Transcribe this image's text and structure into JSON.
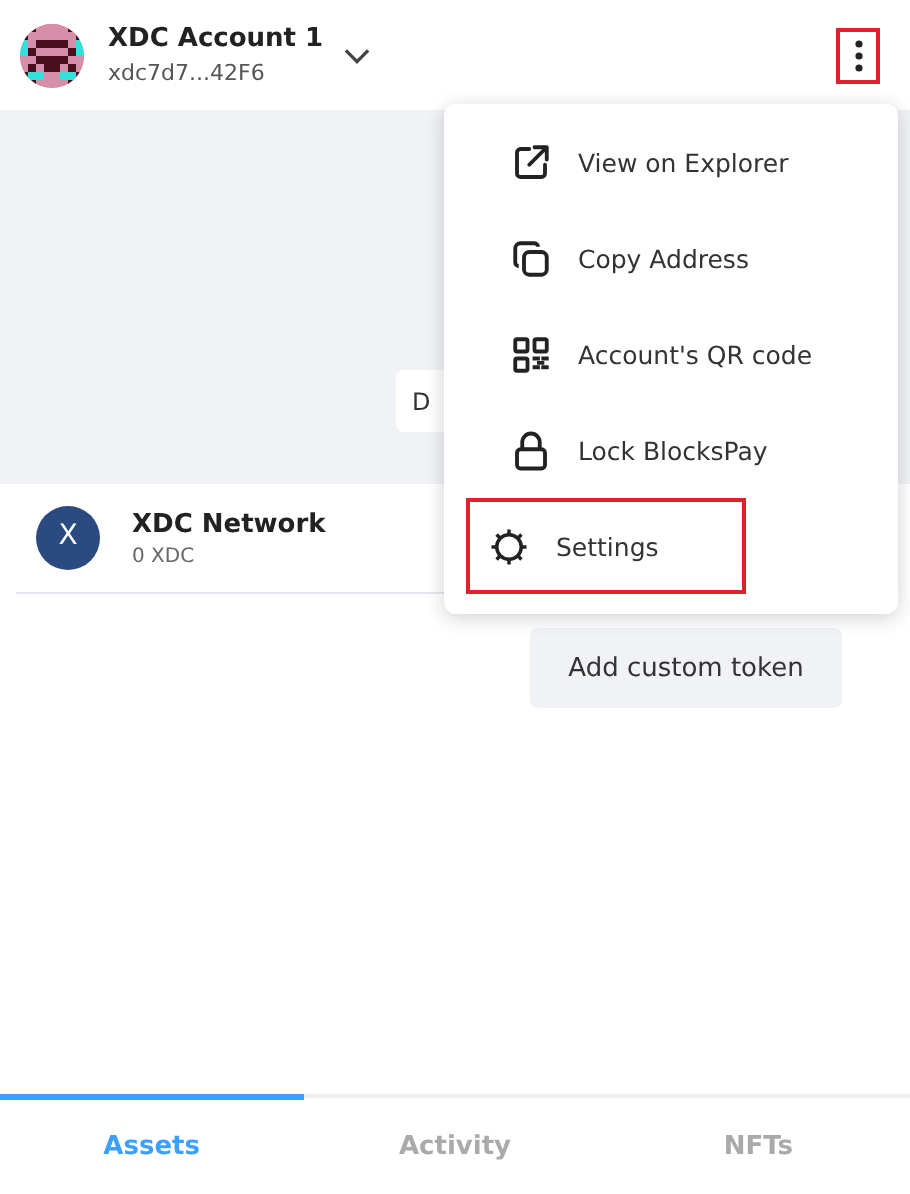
{
  "account": {
    "name": "XDC Account 1",
    "address": "xdc7d7...42F6"
  },
  "header_menu_button": {
    "highlighted": true
  },
  "hidden_button": {
    "label": "D"
  },
  "tokens": [
    {
      "name": "XDC Network",
      "balance": "0 XDC",
      "symbol_letter": "X"
    }
  ],
  "add_token_button": "Add custom token",
  "menu": [
    {
      "kind": "explorer",
      "label": "View on Explorer",
      "highlighted": false
    },
    {
      "kind": "copy",
      "label": "Copy Address",
      "highlighted": false
    },
    {
      "kind": "qr",
      "label": "Account's QR code",
      "highlighted": false
    },
    {
      "kind": "lock",
      "label": "Lock BlocksPay",
      "highlighted": false
    },
    {
      "kind": "settings",
      "label": "Settings",
      "highlighted": true
    }
  ],
  "tabs": [
    {
      "label": "Assets",
      "selected": true
    },
    {
      "label": "Activity",
      "selected": false
    },
    {
      "label": "NFTs",
      "selected": false
    }
  ]
}
